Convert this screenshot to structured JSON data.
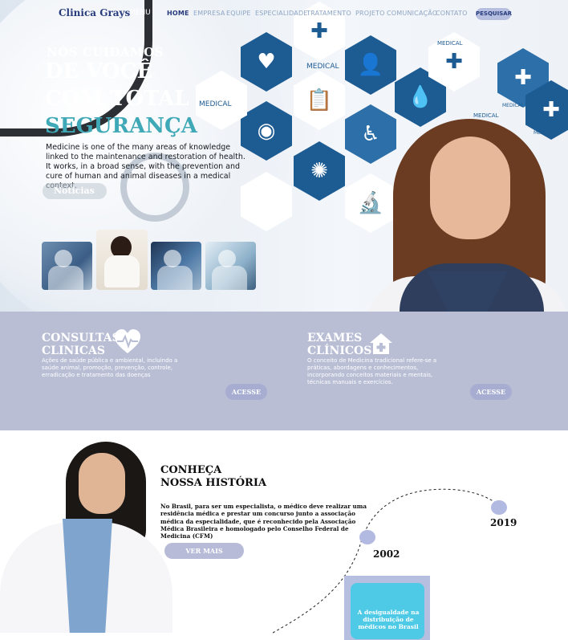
{
  "nav": {
    "brand": "Clinica Grays",
    "menu": "MENU",
    "links": [
      "HOME",
      "EMPRESA",
      "EQUIPE",
      "ESPECIALIDADE",
      "TRATAMENTO",
      "PROJETO",
      "COMUNICAÇÃO",
      "CONTATO"
    ],
    "search": "PESQUISAR"
  },
  "hero": {
    "line1": "NÓS CUIDAMOS",
    "line2": "DE VOCÊ",
    "line3": "COM TOTAL",
    "line4": "SEGURANÇA",
    "text": "Medicine is one of the many areas of knowledge linked to the maintenance and restoration of health. It works, in a broad sense, with the prevention and cure of human and animal diseases in a medical context.",
    "button": "Noticias",
    "hex_labels": [
      "MEDICAL",
      "MEDICAL",
      "MEDICAL",
      "MEDICAL",
      "MEDICAL",
      "MEDICAL"
    ]
  },
  "services": {
    "card1": {
      "title_a": "CONSULTAS",
      "title_b": "CLINICAS",
      "text": "Ações de saúde pública e ambiental, incluindo a saúde animal, promoção, prevenção, controle, erradicação e tratamento das doenças",
      "button": "ACESSE"
    },
    "card2": {
      "title_a": "EXAMES",
      "title_b": "CLÍNICOS",
      "text": "O conceito de Medicina tradicional refere-se a práticas, abordagens e conhecimentos, incorporando conceitos materiais e mentais, técnicas manuais e exercícios.",
      "button": "ACESSE"
    }
  },
  "history": {
    "title_a": "CONHEÇA",
    "title_b": "NOSSA HISTÓRIA",
    "text": "No Brasil, para ser um especialista, o médico deve realizar uma residência médica e prestar um concurso junto a associação médica da especialidade, que é reconhecido pela Associação Médica Brasileira e homologado pelo Conselho Federal de Medicina (CFM)",
    "button": "VER MAIS",
    "year1": "2019",
    "year2": "2002",
    "card_text": "A desigualdade na distribuição de médicos no Brasil"
  },
  "colors": {
    "brand": "#283b7c",
    "accent_teal": "#3fa9b7",
    "services_bg": "#b9bed5",
    "button_lilac": "#b7bbd8",
    "hex_blue": "#1d5b93"
  }
}
